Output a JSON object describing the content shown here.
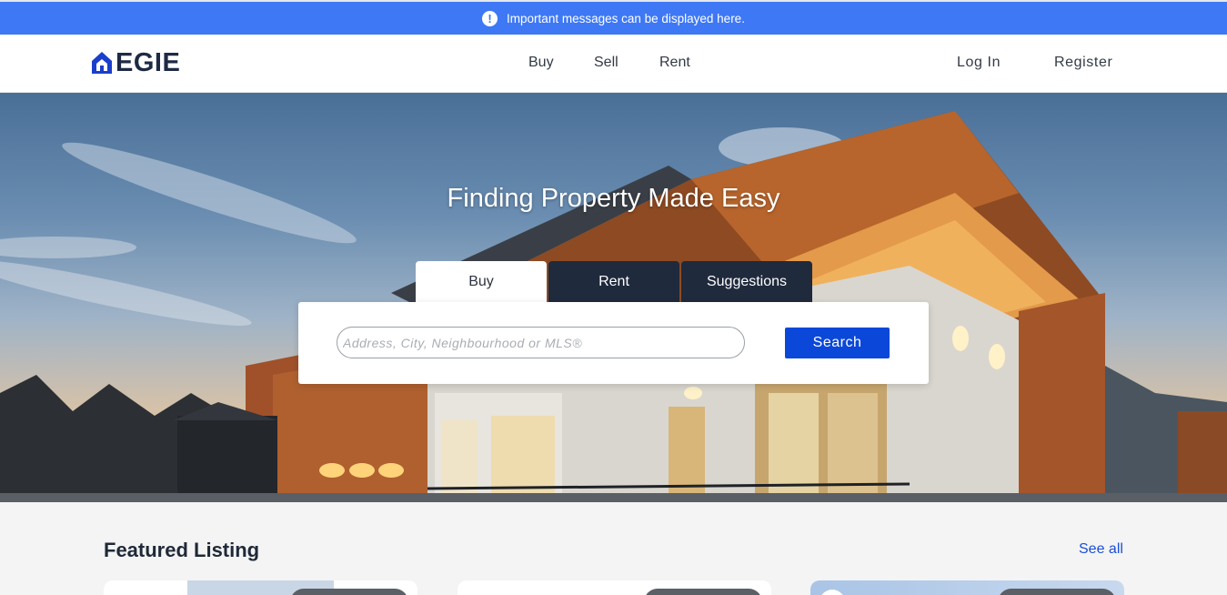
{
  "notice": {
    "text": "Important messages can be displayed here."
  },
  "brand": {
    "name": "EGIE",
    "color": "#1e2a44",
    "accent": "#1a3fcc"
  },
  "nav": {
    "center": [
      {
        "label": "Buy"
      },
      {
        "label": "Sell"
      },
      {
        "label": "Rent"
      }
    ],
    "login": "Log In",
    "register": "Register"
  },
  "hero": {
    "title": "Finding Property Made Easy",
    "tabs": [
      {
        "label": "Buy",
        "active": true
      },
      {
        "label": "Rent",
        "active": false
      },
      {
        "label": "Suggestions",
        "active": false
      }
    ],
    "search": {
      "placeholder": "Address, City, Neighbourhood or MLS®",
      "button": "Search",
      "value": ""
    }
  },
  "featured": {
    "title": "Featured Listing",
    "see_all": "See all"
  },
  "colors": {
    "notice_bg": "#3e78f5",
    "search_button": "#0b48d9",
    "tab_dark": "#1f2a3c",
    "link": "#1a4fd6"
  }
}
